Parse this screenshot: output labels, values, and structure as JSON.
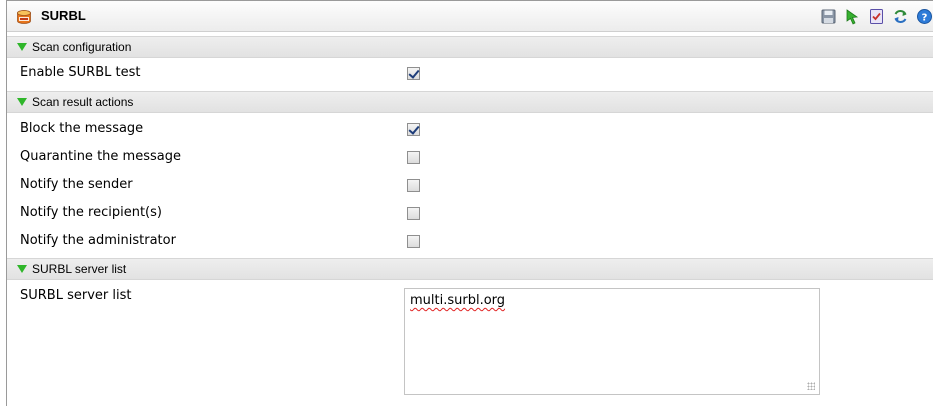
{
  "panel": {
    "title": "SURBL",
    "title_icon": "database-icon",
    "toolbar": [
      "save-icon",
      "run-icon",
      "validate-icon",
      "refresh-icon",
      "help-icon"
    ]
  },
  "sections": [
    {
      "title": "Scan configuration",
      "rows": [
        {
          "label": "Enable SURBL test",
          "checked": true
        }
      ]
    },
    {
      "title": "Scan result actions",
      "rows": [
        {
          "label": "Block the message",
          "checked": true
        },
        {
          "label": "Quarantine the message",
          "checked": false
        },
        {
          "label": "Notify the sender",
          "checked": false
        },
        {
          "label": "Notify the recipient(s)",
          "checked": false
        },
        {
          "label": "Notify the administrator",
          "checked": false
        }
      ]
    },
    {
      "title": "SURBL server list",
      "field": {
        "label": "SURBL server list",
        "value": "multi.surbl.org"
      }
    }
  ]
}
